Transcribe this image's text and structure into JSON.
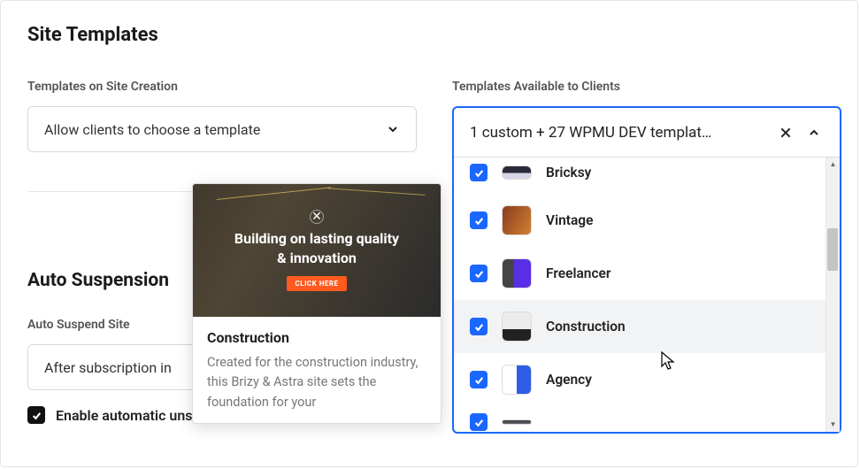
{
  "page": {
    "title": "Site Templates"
  },
  "creation": {
    "label": "Templates on Site Creation",
    "selected": "Allow clients to choose a template"
  },
  "available": {
    "label": "Templates Available to Clients",
    "summary": "1 custom + 27 WPMU DEV templat…",
    "items": [
      {
        "name": "Bricksy",
        "checked": true,
        "thumb": "bricksy"
      },
      {
        "name": "Vintage",
        "checked": true,
        "thumb": "vintage"
      },
      {
        "name": "Freelancer",
        "checked": true,
        "thumb": "freelancer"
      },
      {
        "name": "Construction",
        "checked": true,
        "thumb": "construction",
        "highlight": true
      },
      {
        "name": "Agency",
        "checked": true,
        "thumb": "agency"
      },
      {
        "name": "",
        "checked": true,
        "thumb": "next"
      }
    ]
  },
  "auto_suspension": {
    "heading": "Auto Suspension",
    "suspend_label": "Auto Suspend Site",
    "suspend_value": "After subscription in",
    "unsuspend_checked": true,
    "unsuspend_label": "Enable automatic unsuspension when the pending in"
  },
  "tooltip": {
    "hero_headline": "Building on lasting quality & innovation",
    "hero_cta": "CLICK HERE",
    "title": "Construction",
    "description": "Created for the construction industry, this Brizy & Astra site sets the foundation for your"
  }
}
